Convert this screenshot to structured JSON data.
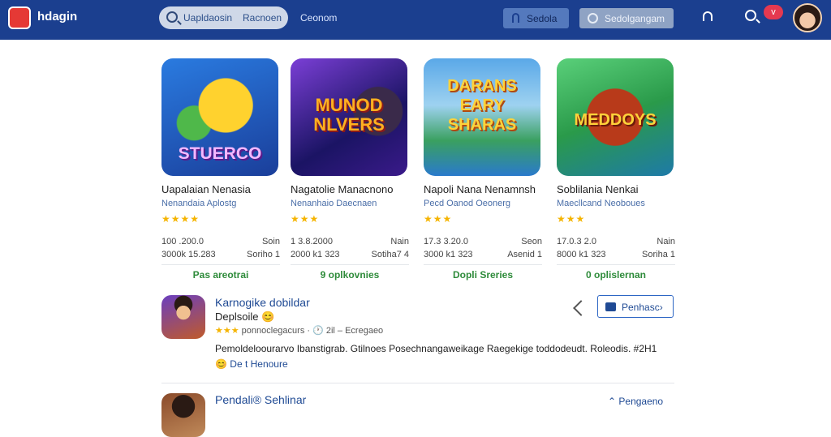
{
  "header": {
    "brand": "hdagin",
    "search_text": "Uapldaosin",
    "search_text2": "Racnoen",
    "nav_link": "Ceonom",
    "button_primary": "Sedola",
    "button_secondary": "Sedolgangam",
    "notification_badge": "v"
  },
  "cards": [
    {
      "thumb_text": "STUERCO",
      "title": "Uapalaian Nenasia",
      "subtitle": "Nenandaia Aplostg",
      "rating": "★★★★",
      "meta_line1": "100 .200.0",
      "meta_line2": "3000k 15.283",
      "meta_right1": "Soin",
      "meta_right2": "Soriho 1",
      "link": "Pas areotrai"
    },
    {
      "thumb_text": "MUNOD NLVERS",
      "title": "Nagatolie Manacnono",
      "subtitle": "Nenanhaio Daecnaen",
      "rating": "★★★",
      "meta_line1": "1 3.8.2000",
      "meta_line2": "2000 k1 323",
      "meta_right1": "Nain",
      "meta_right2": "Sotiha7 4",
      "link": "9 oplkovnies"
    },
    {
      "thumb_text": "DARANS EARY SHARAS",
      "title": "Napoli Nana Nenamnsh",
      "subtitle": "Pecd Oanod Oeonerg",
      "rating": "★★★",
      "meta_line1": "17.3 3.20.0",
      "meta_line2": "3000 k1 323",
      "meta_right1": "Seon",
      "meta_right2": "Asenid 1",
      "link": "Dopli Sreries"
    },
    {
      "thumb_text": "MEDDOYS",
      "title": "Soblilania Nenkai",
      "subtitle": "Maecllcand Neoboues",
      "rating": "★★★",
      "meta_line1": "17.0.3 2.0",
      "meta_line2": "8000 k1 323",
      "meta_right1": "Nain",
      "meta_right2": "Soriha 1",
      "link": "0 oplislernan"
    }
  ],
  "list": [
    {
      "title": "Karnogike dobildar",
      "subtitle": "Deplsoile 😊",
      "rating": "★★★",
      "meta": "ponnoclegacurs · 🕐 2il – Ecregaeo",
      "description": "Pemoldeloourarvo Ibanstigrab. Gtilnoes Posechnangaweikage Raegekige toddodeudt. Roleodis. #2H1",
      "more": "😊 De t Henoure",
      "button": "Penhasc›"
    },
    {
      "title": "Pendali® Sehlinar",
      "link": "⌃ Pengaeno"
    }
  ]
}
